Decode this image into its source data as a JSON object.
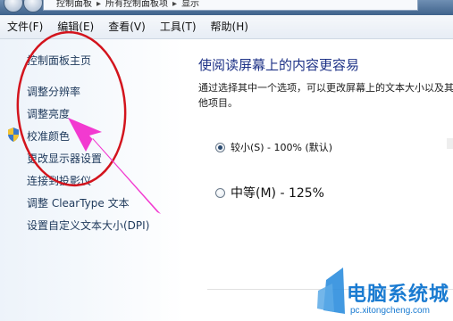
{
  "address_bar": {
    "segments": [
      "控制面板",
      "所有控制面板项",
      "显示"
    ]
  },
  "menu": [
    "文件(F)",
    "编辑(E)",
    "查看(V)",
    "工具(T)",
    "帮助(H)"
  ],
  "sidebar": {
    "items": [
      {
        "label": "控制面板主页"
      },
      {
        "label": "调整分辨率"
      },
      {
        "label": "调整亮度"
      },
      {
        "label": "校准颜色"
      },
      {
        "label": "更改显示器设置"
      },
      {
        "label": "连接到投影仪"
      },
      {
        "label": "调整 ClearType 文本"
      },
      {
        "label": "设置自定义文本大小(DPI)"
      }
    ]
  },
  "main": {
    "heading": "使阅读屏幕上的内容更容易",
    "description": "通过选择其中一个选项，可以更改屏幕上的文本大小以及其他项目。",
    "options": [
      {
        "label": "较小(S) - 100% (默认)",
        "selected": true
      },
      {
        "label": "中等(M) - 125%",
        "selected": false
      }
    ]
  },
  "annotation": {
    "circle_color": "#d3141d",
    "arrow_color": "#f23ad0"
  },
  "watermark": {
    "title": "电脑系统城",
    "url": "pc.xitongcheng.com"
  }
}
